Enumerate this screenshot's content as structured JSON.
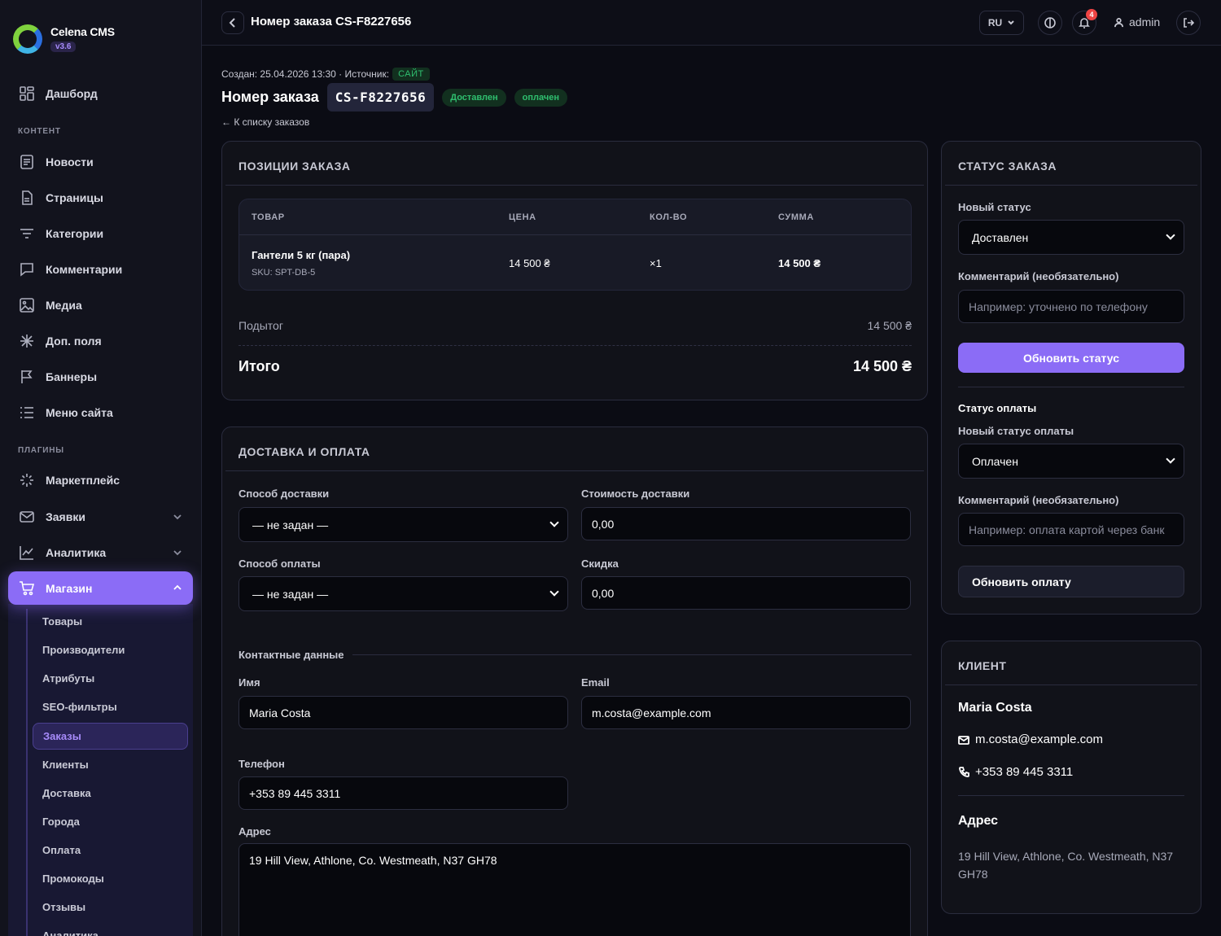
{
  "brand": {
    "name": "Celena CMS",
    "version": "v3.6"
  },
  "sidebar": {
    "items": [
      {
        "label": "Дашборд",
        "icon": "dashboard-icon"
      },
      {
        "label": "Новости",
        "icon": "news-icon"
      },
      {
        "label": "Страницы",
        "icon": "page-icon"
      },
      {
        "label": "Категории",
        "icon": "filter-icon"
      },
      {
        "label": "Комментарии",
        "icon": "comment-icon"
      },
      {
        "label": "Медиа",
        "icon": "image-icon"
      },
      {
        "label": "Доп. поля",
        "icon": "sparkle-icon"
      },
      {
        "label": "Баннеры",
        "icon": "flag-icon"
      },
      {
        "label": "Меню сайта",
        "icon": "list-icon"
      },
      {
        "label": "Маркетплейс",
        "icon": "loader-icon"
      },
      {
        "label": "Заявки",
        "icon": "mail-icon"
      },
      {
        "label": "Аналитика",
        "icon": "chart-icon"
      },
      {
        "label": "Магазин",
        "icon": "cart-icon"
      }
    ],
    "sections": {
      "content": "КОНТЕНТ",
      "plugins": "ПЛАГИНЫ"
    },
    "shop_sub": [
      "Товары",
      "Производители",
      "Атрибуты",
      "SEO-фильтры",
      "Заказы",
      "Клиенты",
      "Доставка",
      "Города",
      "Оплата",
      "Промокоды",
      "Отзывы",
      "Аналитика"
    ]
  },
  "topbar": {
    "title": "Номер заказа CS-F8227656",
    "lang": "RU",
    "notifications": "4",
    "user": "admin"
  },
  "order": {
    "meta": "Создан: 25.04.2026 13:30 · Источник:",
    "source": "САЙТ",
    "heading": "Номер заказа",
    "code": "CS-F8227656",
    "status": "Доставлен",
    "payment": "оплачен",
    "back": "← К списку заказов"
  },
  "items_card": {
    "title": "ПОЗИЦИИ ЗАКАЗА",
    "columns": [
      "ТОВАР",
      "ЦЕНА",
      "КОЛ-ВО",
      "СУММА"
    ],
    "rows": [
      {
        "name": "Гантели 5 кг (пара)",
        "sku": "SKU: SPT-DB-5",
        "price": "14 500 ₴",
        "qty": "×1",
        "sum": "14 500 ₴"
      }
    ],
    "subtotal_label": "Подытог",
    "subtotal": "14 500 ₴",
    "total_label": "Итого",
    "total": "14 500 ₴"
  },
  "delivery_card": {
    "title": "ДОСТАВКА И ОПЛАТА",
    "delivery_method_label": "Способ доставки",
    "delivery_method": "— не задан —",
    "delivery_cost_label": "Стоимость доставки",
    "delivery_cost": "0,00",
    "payment_method_label": "Способ оплаты",
    "payment_method": "— не задан —",
    "discount_label": "Скидка",
    "discount": "0,00",
    "contacts_label": "Контактные данные",
    "name_label": "Имя",
    "name": "Maria Costa",
    "email_label": "Email",
    "email": "m.costa@example.com",
    "phone_label": "Телефон",
    "phone": "+353 89 445 3311",
    "address_label": "Адрес",
    "address": "19 Hill View, Athlone, Co. Westmeath, N37 GH78"
  },
  "status_card": {
    "title": "СТАТУС ЗАКАЗА",
    "new_status_label": "Новый статус",
    "new_status": "Доставлен",
    "comment_label": "Комментарий (необязательно)",
    "comment_placeholder": "Например: уточнено по телефону",
    "update_button": "Обновить статус",
    "payment_section": "Статус оплаты",
    "new_payment_label": "Новый статус оплаты",
    "new_payment": "Оплачен",
    "payment_comment_label": "Комментарий (необязательно)",
    "payment_comment_placeholder": "Например: оплата картой через банк",
    "update_payment_button": "Обновить оплату"
  },
  "client_card": {
    "title": "КЛИЕНТ",
    "name": "Maria Costa",
    "email": "m.costa@example.com",
    "phone": "+353 89 445 3311",
    "address_title": "Адрес",
    "address": "19 Hill View, Athlone, Co. Westmeath, N37 GH78"
  },
  "colors": {
    "accent": "#8b6cf6",
    "success": "#2fbf6f",
    "danger": "#ef4444",
    "background": "#0b0c14"
  }
}
